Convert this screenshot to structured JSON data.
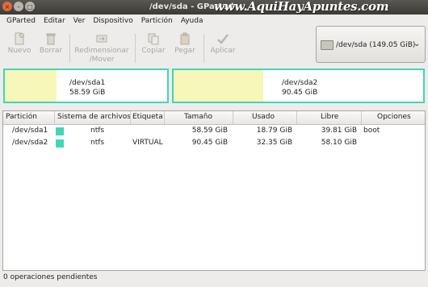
{
  "window": {
    "title": "/dev/sda - GParted",
    "watermark": "www.AquiHayApuntes.com",
    "buttons": [
      "×",
      "–",
      "□"
    ]
  },
  "menu": [
    "GParted",
    "Editar",
    "Ver",
    "Dispositivo",
    "Partición",
    "Ayuda"
  ],
  "toolbar": {
    "nuevo": "Nuevo",
    "borrar": "Borrar",
    "redimensionar_1": "Redimensionar",
    "redimensionar_2": "/Mover",
    "copiar": "Copiar",
    "pegar": "Pegar",
    "aplicar": "Aplicar"
  },
  "device": {
    "label": "/dev/sda  (149.05 GiB)",
    "chevron": "⌄"
  },
  "partition_map": [
    {
      "name": "/dev/sda1",
      "size": "58.59 GiB",
      "used_fraction": 0.32
    },
    {
      "name": "/dev/sda2",
      "size": "90.45 GiB",
      "used_fraction": 0.36
    }
  ],
  "columns": [
    "Partición",
    "Sistema de archivos",
    "Etiqueta",
    "Tamaño",
    "Usado",
    "Libre",
    "Opciones"
  ],
  "rows": [
    {
      "particion": "/dev/sda1",
      "fs": "ntfs",
      "etiqueta": "",
      "tamano": "58.59 GiB",
      "usado": "18.79 GiB",
      "libre": "39.81 GiB",
      "opciones": "boot"
    },
    {
      "particion": "/dev/sda2",
      "fs": "ntfs",
      "etiqueta": "VIRTUAL",
      "tamano": "90.45 GiB",
      "usado": "32.35 GiB",
      "libre": "58.10 GiB",
      "opciones": ""
    }
  ],
  "status": "0 operaciones pendientes",
  "colors": {
    "partition_ntfs": "#42d5b8",
    "used_space": "#f6f7b8"
  }
}
